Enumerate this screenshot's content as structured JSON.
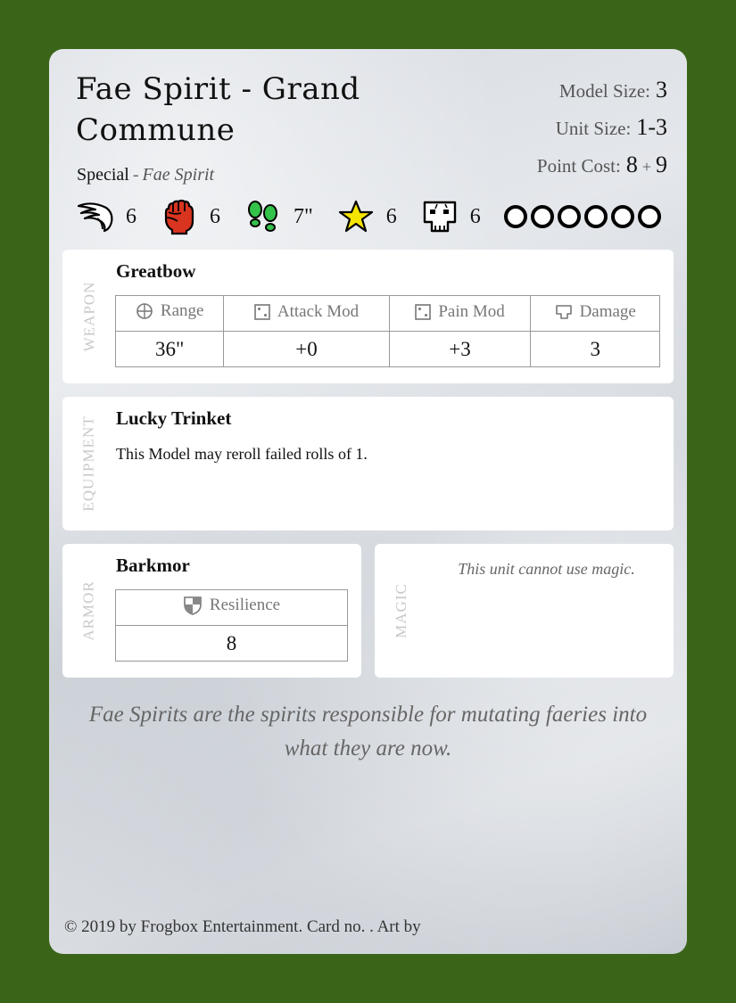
{
  "unit": {
    "title": "Fae Spirit - Grand Commune",
    "type": "Special",
    "separator": "-",
    "faction": "Fae Spirit"
  },
  "info": {
    "model_size_label": "Model Size:",
    "model_size": "3",
    "unit_size_label": "Unit Size:",
    "unit_size": "1-3",
    "point_cost_label": "Point Cost:",
    "point_cost_base": "8",
    "point_cost_plus": "+",
    "point_cost_extra": "9"
  },
  "stats": [
    {
      "icon": "wing-icon",
      "value": "6"
    },
    {
      "icon": "fist-icon",
      "value": "6"
    },
    {
      "icon": "footprints-icon",
      "value": "7\""
    },
    {
      "icon": "star-icon",
      "value": "6"
    },
    {
      "icon": "skull-icon",
      "value": "6"
    }
  ],
  "wounds_count": 6,
  "weapon": {
    "section_label": "WEAPON",
    "name": "Greatbow",
    "headers": [
      {
        "icon": "crosshair-icon",
        "label": "Range"
      },
      {
        "icon": "die-icon",
        "label": "Attack Mod"
      },
      {
        "icon": "die-icon",
        "label": "Pain Mod"
      },
      {
        "icon": "damage-icon",
        "label": "Damage"
      }
    ],
    "values": [
      "36\"",
      "+0",
      "+3",
      "3"
    ]
  },
  "equipment": {
    "section_label": "EQUIPMENT",
    "name": "Lucky Trinket",
    "text": "This Model may reroll failed rolls of 1."
  },
  "armor": {
    "section_label": "ARMOR",
    "name": "Barkmor",
    "header_icon": "shield-icon",
    "header_label": "Resilience",
    "value": "8"
  },
  "magic": {
    "section_label": "MAGIC",
    "text": "This unit cannot use magic."
  },
  "flavor": "Fae Spirits are the spirits responsible for mutating faeries into what they are now.",
  "footer": "© 2019 by Frogbox Entertainment. Card no. . Art by",
  "colors": {
    "background": "#3a6519",
    "fist": "#d9341f",
    "footprints": "#33c24a",
    "star": "#f5e400"
  }
}
